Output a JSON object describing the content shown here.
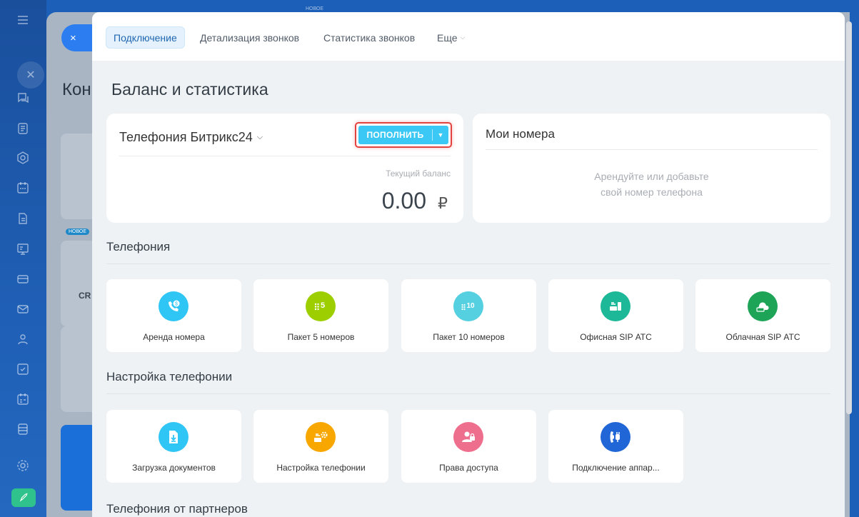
{
  "top_badge": "НОВОЕ",
  "background_page": {
    "title": "Кон",
    "badge": "НОВОЕ",
    "label": "CR"
  },
  "close_label": "×",
  "tabs": [
    {
      "label": "Подключение",
      "active": true
    },
    {
      "label": "Детализация звонков"
    },
    {
      "label": "Статистика звонков"
    },
    {
      "label": "Еще"
    }
  ],
  "page_title": "Баланс и статистика",
  "balance": {
    "provider": "Телефония Битрикс24",
    "topup_label": "пополнить",
    "current_label": "Текущий баланс",
    "amount": "0.00",
    "currency": "₽"
  },
  "numbers": {
    "title": "Мои номера",
    "hint_line1": "Арендуйте или добавьте",
    "hint_line2": "свой номер телефона"
  },
  "sections": {
    "telephony": "Телефония",
    "settings": "Настройка телефонии",
    "partners": "Телефония от партнеров"
  },
  "telephony_tiles": [
    {
      "label": "Аренда номера",
      "icon": "rent-number-icon",
      "color": "#2fc6f6"
    },
    {
      "label": "Пакет 5 номеров",
      "icon": "package-5-icon",
      "color": "#9dcf00",
      "glyph": "5"
    },
    {
      "label": "Пакет 10 номеров",
      "icon": "package-10-icon",
      "color": "#55d0e0",
      "glyph": "10"
    },
    {
      "label": "Офисная SIP АТС",
      "icon": "office-sip-icon",
      "color": "#1db898"
    },
    {
      "label": "Облачная SIP АТС",
      "icon": "cloud-sip-icon",
      "color": "#1da457"
    }
  ],
  "settings_tiles": [
    {
      "label": "Загрузка документов",
      "icon": "upload-docs-icon",
      "color": "#2fc6f6"
    },
    {
      "label": "Настройка телефонии",
      "icon": "telephony-settings-icon",
      "color": "#f7a700"
    },
    {
      "label": "Права доступа",
      "icon": "access-rights-icon",
      "color": "#ee6e8e"
    },
    {
      "label": "Подключение аппар...",
      "icon": "connect-device-icon",
      "color": "#2066d6"
    }
  ]
}
